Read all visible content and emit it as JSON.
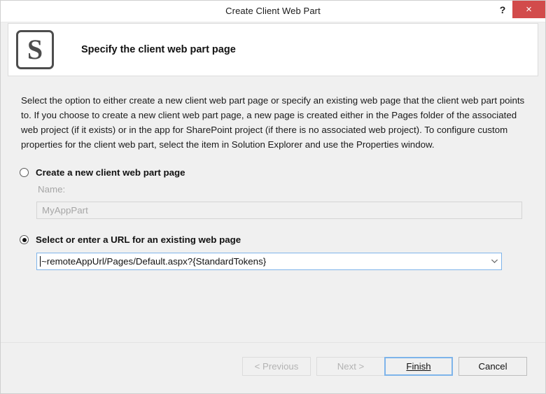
{
  "window": {
    "title": "Create Client Web Part",
    "help_label": "?",
    "close_label": "×"
  },
  "header": {
    "icon_letter": "S",
    "title": "Specify the client web part page"
  },
  "body": {
    "description": "Select the option to either create a new client web part page or specify an existing web page that the client web part points to. If you choose to create a new client web part page, a new page is created either in the Pages folder of the associated web project (if it exists) or in the app for SharePoint project (if there is no associated web project). To configure custom properties for the client web part, select the item in Solution Explorer and use the Properties window.",
    "options": [
      {
        "id": "create-new",
        "label": "Create a new client web part page",
        "selected": false
      },
      {
        "id": "existing-url",
        "label": "Select or enter a URL for an existing web page",
        "selected": true
      }
    ],
    "name_field": {
      "label": "Name:",
      "value": "MyAppPart",
      "disabled": true
    },
    "url_field": {
      "value": "~remoteAppUrl/Pages/Default.aspx?{StandardTokens}",
      "dropdown_icon": "chevron-down-icon"
    }
  },
  "footer": {
    "buttons": [
      {
        "id": "previous",
        "label": "< Previous",
        "disabled": true
      },
      {
        "id": "next",
        "label": "Next >",
        "disabled": true
      },
      {
        "id": "finish",
        "label": "Finish",
        "disabled": false,
        "default": true
      },
      {
        "id": "cancel",
        "label": "Cancel",
        "disabled": false
      }
    ]
  },
  "colors": {
    "dialog_background": "#f0f0f0",
    "panel_background": "#ffffff",
    "close_button": "#d24b4b",
    "focus_border": "#7eb4ea",
    "disabled_text": "#a6a6a6"
  }
}
